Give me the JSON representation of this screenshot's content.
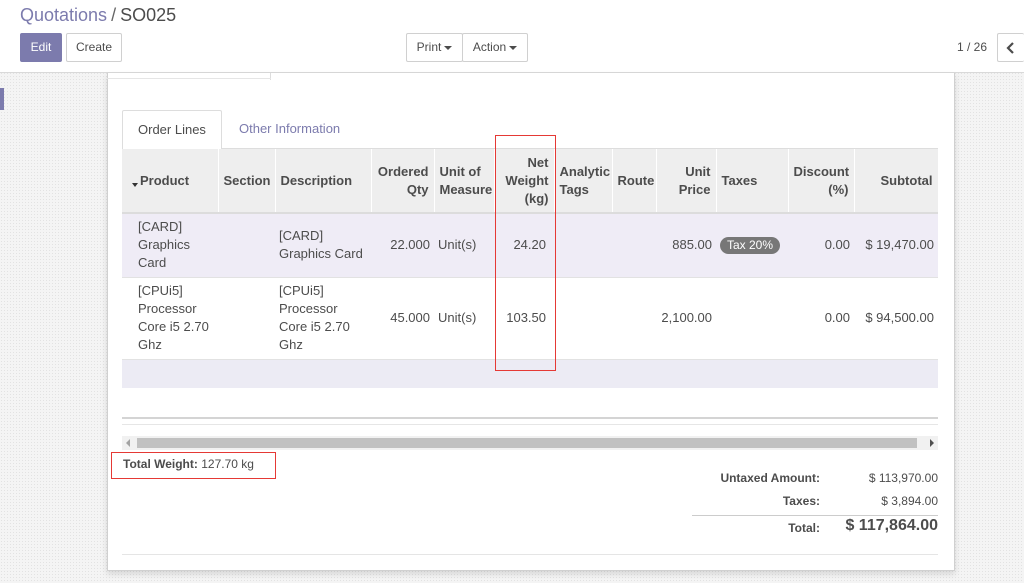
{
  "breadcrumb": {
    "parent": "Quotations",
    "separator": "/",
    "current": "SO025"
  },
  "buttons": {
    "edit": "Edit",
    "create": "Create",
    "print": "Print",
    "action": "Action"
  },
  "pager": {
    "value": "1 / 26"
  },
  "tabs": [
    {
      "label": "Order Lines",
      "active": true
    },
    {
      "label": "Other Information",
      "active": false
    }
  ],
  "table": {
    "headers": {
      "product": "Product",
      "section": "Section",
      "description": "Description",
      "ordered_qty": "Ordered Qty",
      "uom": "Unit of Measure",
      "net_weight": "Net Weight (kg)",
      "analytic_tags": "Analytic Tags",
      "route": "Route",
      "unit_price": "Unit Price",
      "taxes": "Taxes",
      "discount": "Discount (%)",
      "subtotal": "Subtotal"
    },
    "rows": [
      {
        "product": "[CARD] Graphics Card",
        "section": "",
        "description": "[CARD] Graphics Card",
        "ordered_qty": "22.000",
        "uom": "Unit(s)",
        "net_weight": "24.20",
        "analytic_tags": "",
        "route": "",
        "unit_price": "885.00",
        "taxes": "Tax 20%",
        "discount": "0.00",
        "subtotal": "$ 19,470.00"
      },
      {
        "product": "[CPUi5] Processor Core i5 2.70 Ghz",
        "section": "",
        "description": "[CPUi5] Processor Core i5 2.70 Ghz",
        "ordered_qty": "45.000",
        "uom": "Unit(s)",
        "net_weight": "103.50",
        "analytic_tags": "",
        "route": "",
        "unit_price": "2,100.00",
        "taxes": "",
        "discount": "0.00",
        "subtotal": "$ 94,500.00"
      }
    ]
  },
  "total_weight": {
    "label": "Total Weight:",
    "value": "127.70 kg"
  },
  "totals": {
    "untaxed_label": "Untaxed Amount:",
    "untaxed_value": "$ 113,970.00",
    "taxes_label": "Taxes:",
    "taxes_value": "$ 3,894.00",
    "total_label": "Total:",
    "total_value": "$ 117,864.00"
  },
  "colors": {
    "primary": "#7c7bad",
    "highlight": "#e53935",
    "badge": "#777777"
  },
  "icons": {
    "pager_prev": "chevron-left-icon",
    "sort": "caret-down-icon"
  }
}
